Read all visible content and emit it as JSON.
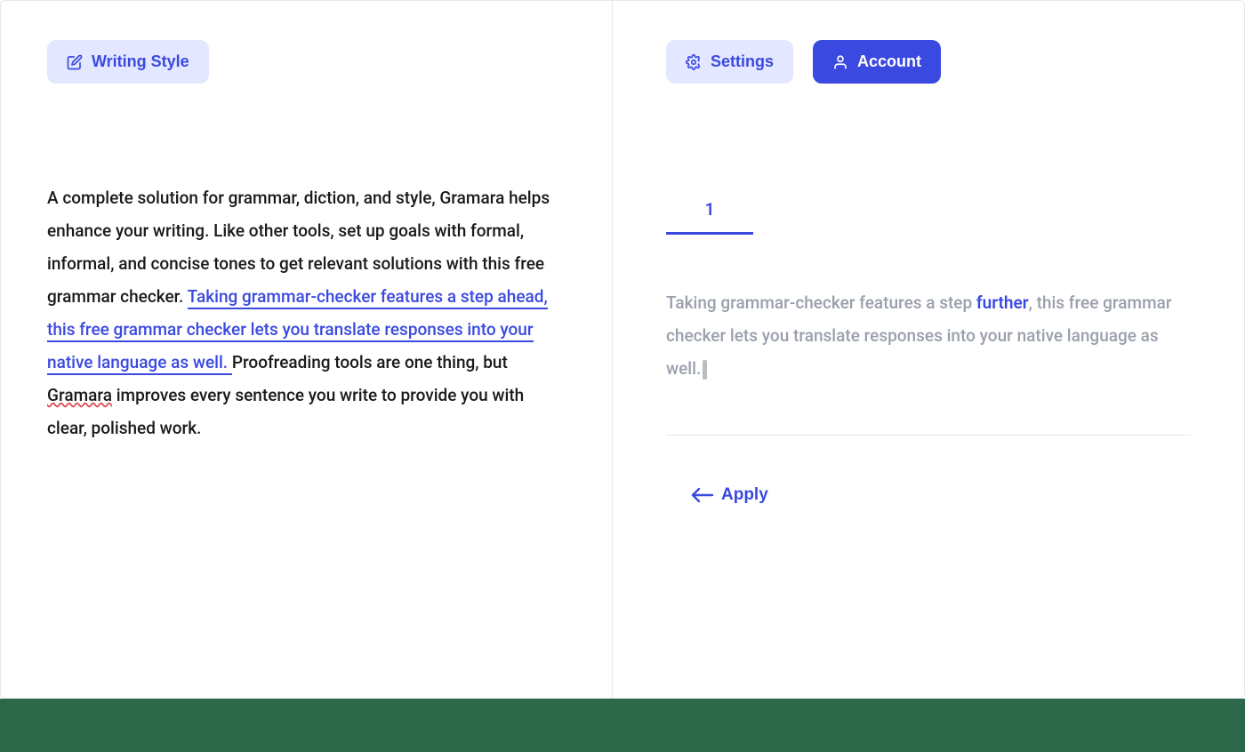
{
  "left": {
    "writing_style_label": "Writing Style",
    "text_before": "A complete solution for grammar, diction, and style, Gramara helps enhance your writing. Like other tools, set up goals with formal, informal, and concise tones to get relevant solutions with this free grammar checker. ",
    "text_highlight": "Taking grammar-checker features a step ahead, this free grammar checker lets you translate responses into your native language as well. ",
    "text_after_1": "Proofreading tools are one thing, but ",
    "text_spellcheck": "Gramara",
    "text_after_2": " improves every sentence you write to provide you with clear, polished work."
  },
  "right": {
    "settings_label": "Settings",
    "account_label": "Account",
    "tab_number": "1",
    "suggestion_before": "Taking grammar-checker features a step ",
    "suggestion_word": "further",
    "suggestion_after": ", this free grammar checker lets you translate responses into your native language as well.",
    "apply_label": "Apply"
  }
}
